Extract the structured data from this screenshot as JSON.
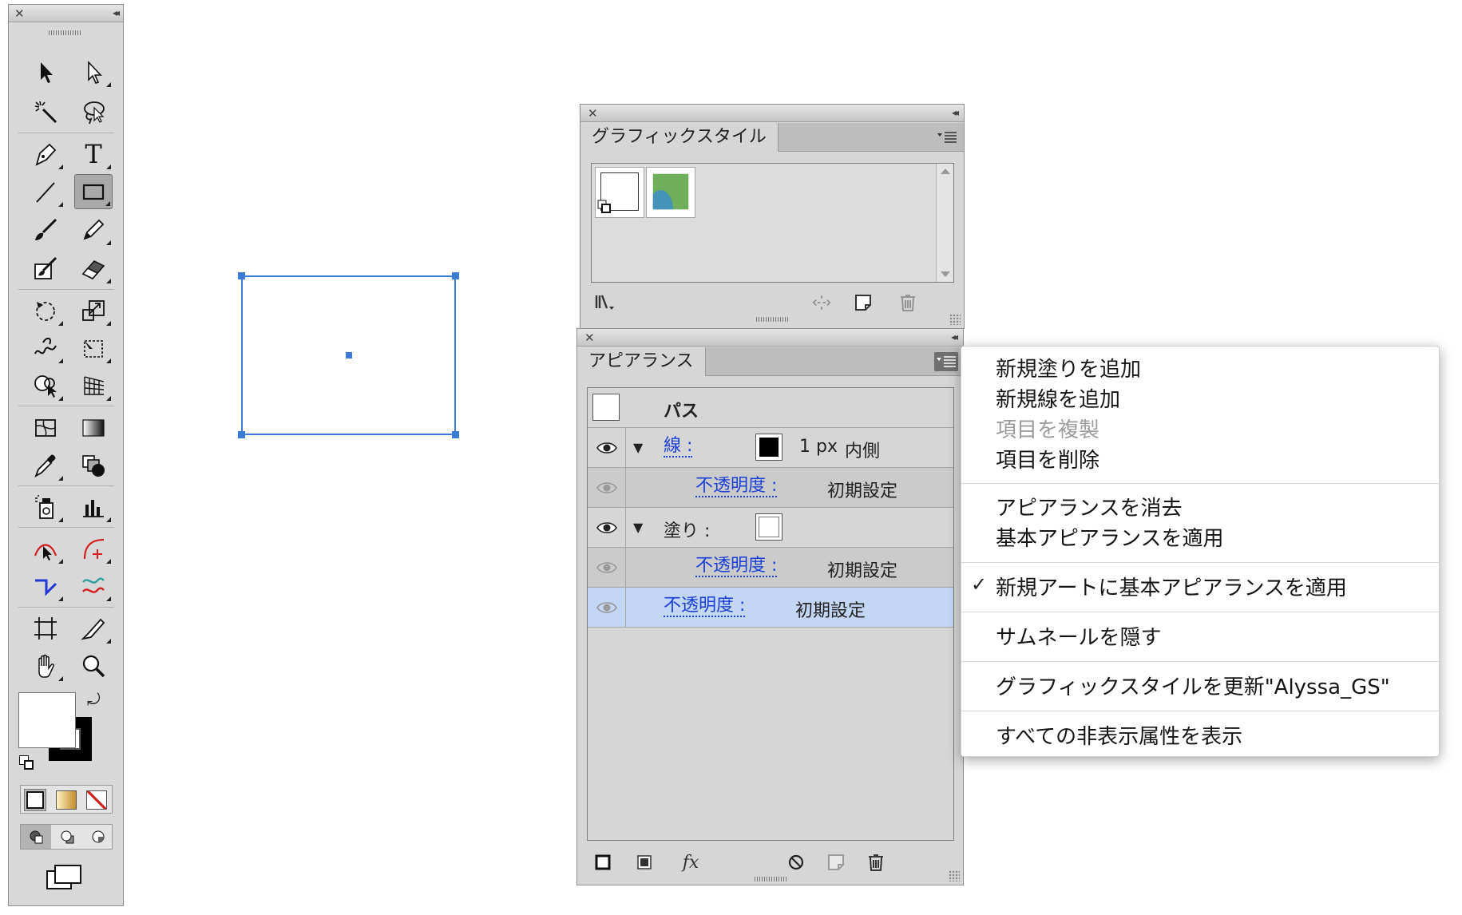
{
  "tools_panel": {
    "close_glyph": "✕",
    "collapse_glyph": "◂◂",
    "tools": [
      "selection-tool",
      "direct-selection-tool",
      "magic-wand-tool",
      "lasso-tool",
      "pen-tool",
      "type-tool",
      "line-segment-tool",
      "rectangle-tool",
      "paintbrush-tool",
      "pencil-tool",
      "blob-brush-tool",
      "eraser-tool",
      "rotate-tool",
      "scale-tool",
      "warp-tool",
      "free-transform-tool",
      "shape-builder-tool",
      "perspective-grid-tool",
      "mesh-tool",
      "gradient-tool",
      "eyedropper-tool",
      "blend-tool",
      "symbol-sprayer-tool",
      "column-graph-tool",
      "anchor-point-tool",
      "add-anchor-tool",
      "convert-anchor-tool",
      "smooth-tool",
      "artboard-tool",
      "slice-tool",
      "hand-tool",
      "zoom-tool"
    ],
    "type_glyph": "T",
    "selected_tool": "rectangle-tool"
  },
  "graphic_styles": {
    "close_glyph": "✕",
    "collapse_glyph": "◂◂",
    "tab_label": "グラフィックスタイル",
    "swatches": [
      "default-style-swatch",
      "alyssa-gs-swatch"
    ],
    "swatch_color_green": "#6fae5b",
    "swatch_color_blue": "#3d8fc8"
  },
  "appearance": {
    "close_glyph": "✕",
    "collapse_glyph": "◂◂",
    "tab_label": "アピアランス",
    "header_label": "パス",
    "twirl": "▼",
    "rows": {
      "stroke_label": "線 :",
      "stroke_weight": "1 px",
      "stroke_align": "内側",
      "stroke_opacity_label": "不透明度 :",
      "stroke_opacity_value": "初期設定",
      "fill_label": "塗り :",
      "fill_opacity_label": "不透明度 :",
      "fill_opacity_value": "初期設定",
      "opacity_label": "不透明度 :",
      "opacity_value": "初期設定"
    },
    "fx_label": "fx"
  },
  "flyout_menu": {
    "check_glyph": "✓",
    "items": [
      {
        "label": "新規塗りを追加",
        "enabled": true
      },
      {
        "label": "新規線を追加",
        "enabled": true
      },
      {
        "label": "項目を複製",
        "enabled": false
      },
      {
        "label": "項目を削除",
        "enabled": true
      },
      {
        "label": "アピアランスを消去",
        "enabled": true
      },
      {
        "label": "基本アピアランスを適用",
        "enabled": true
      },
      {
        "label": "新規アートに基本アピアランスを適用",
        "enabled": true,
        "checked": true
      },
      {
        "label": "サムネールを隠す",
        "enabled": true
      },
      {
        "label": "グラフィックスタイルを更新\"Alyssa_GS\"",
        "enabled": true
      },
      {
        "label": "すべての非表示属性を表示",
        "enabled": true
      }
    ]
  },
  "colors": {
    "selection_blue": "#3a7bd5",
    "link_blue": "#1a3fd6",
    "highlight_row": "#c3d6f3"
  }
}
